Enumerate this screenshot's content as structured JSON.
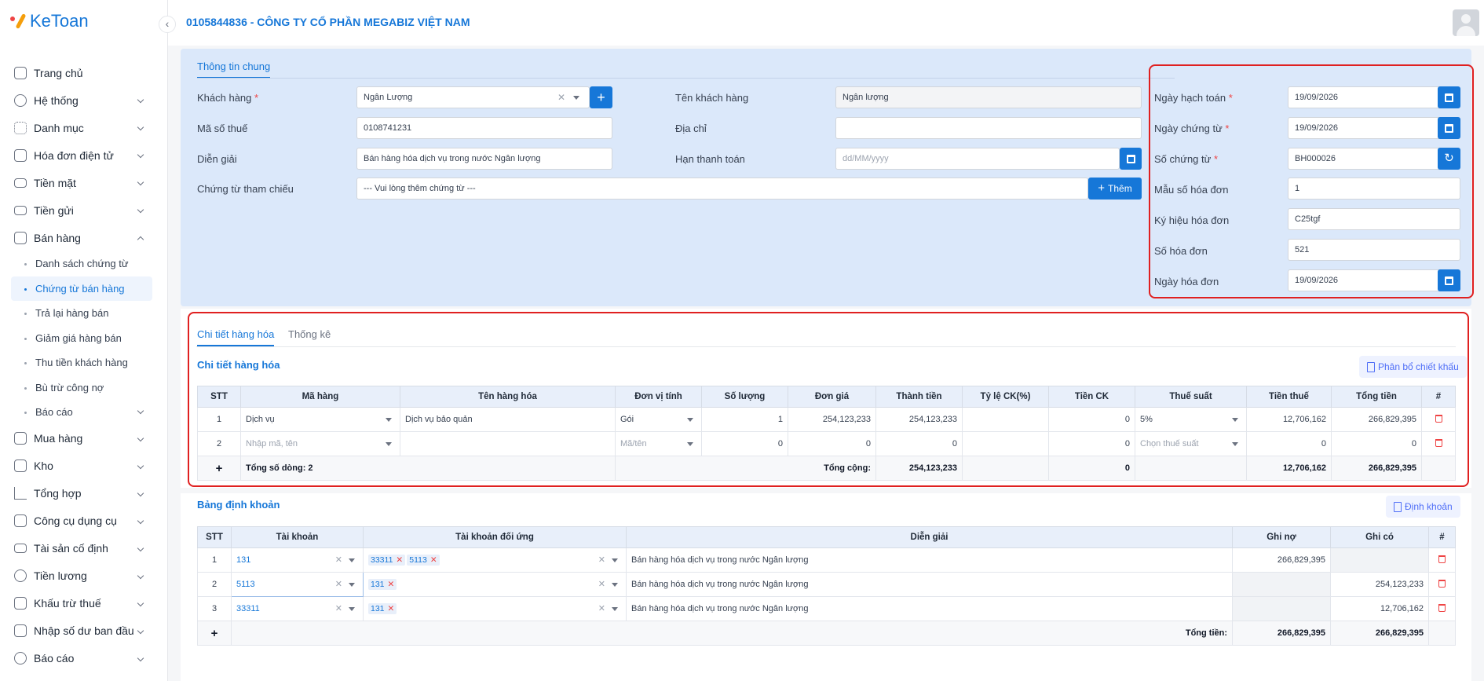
{
  "app": {
    "logo": "KeToan",
    "company": "0105844836 - CÔNG TY CỔ PHẦN MEGABIZ VIỆT NAM"
  },
  "sidebar": {
    "items": [
      {
        "label": "Trang chủ",
        "icon": "home-icon",
        "chev": ""
      },
      {
        "label": "Hệ thống",
        "icon": "gear-icon",
        "chev": "down"
      },
      {
        "label": "Danh mục",
        "icon": "grid-icon",
        "chev": "down"
      },
      {
        "label": "Hóa đơn điện tử",
        "icon": "invoice-icon",
        "chev": "down"
      },
      {
        "label": "Tiền mặt",
        "icon": "cash-icon",
        "chev": "down"
      },
      {
        "label": "Tiền gửi",
        "icon": "card-icon",
        "chev": "down"
      },
      {
        "label": "Bán hàng",
        "icon": "cart-icon",
        "chev": "up"
      }
    ],
    "sub": [
      "Danh sách chứng từ",
      "Chứng từ bán hàng",
      "Trả lại hàng bán",
      "Giảm giá hàng bán",
      "Thu tiền khách hàng",
      "Bù trừ công nợ",
      "Báo cáo"
    ],
    "items2": [
      {
        "label": "Mua hàng",
        "icon": "bag-icon"
      },
      {
        "label": "Kho",
        "icon": "warehouse-icon"
      },
      {
        "label": "Tổng hợp",
        "icon": "chart-icon"
      },
      {
        "label": "Công cụ dụng cụ",
        "icon": "tools-icon"
      },
      {
        "label": "Tài sản cố định",
        "icon": "car-icon"
      },
      {
        "label": "Tiền lương",
        "icon": "dollar-icon"
      },
      {
        "label": "Khấu trừ thuế",
        "icon": "bank-icon"
      },
      {
        "label": "Nhập số dư ban đầu",
        "icon": "edit-icon"
      },
      {
        "label": "Báo cáo",
        "icon": "report-icon"
      }
    ]
  },
  "general": {
    "tab": "Thông tin chung",
    "customer_label": "Khách hàng",
    "customer_value": "Ngân Lượng",
    "tax_label": "Mã số thuế",
    "tax_value": "0108741231",
    "desc_label": "Diễn giải",
    "desc_value": "Bán hàng hóa dịch vụ trong nước Ngân lượng",
    "ref_label": "Chứng từ tham chiếu",
    "ref_placeholder": "--- Vui lòng thêm chứng từ ---",
    "add_label": "Thêm",
    "cname_label": "Tên khách hàng",
    "cname_value": "Ngân lượng",
    "addr_label": "Địa chỉ",
    "addr_value": "",
    "due_label": "Hạn thanh toán",
    "due_placeholder": "dd/MM/yyyy",
    "right": [
      {
        "label": "Ngày hạch toán",
        "req": "*",
        "value": "19/09/2026",
        "btn": "cal"
      },
      {
        "label": "Ngày chứng từ",
        "req": "*",
        "value": "19/09/2026",
        "btn": "cal"
      },
      {
        "label": "Số chứng từ",
        "req": "*",
        "value": "BH000026",
        "btn": "refresh"
      },
      {
        "label": "Mẫu số hóa đơn",
        "req": "",
        "value": "1",
        "btn": ""
      },
      {
        "label": "Ký hiệu hóa đơn",
        "req": "",
        "value": "C25tgf",
        "btn": ""
      },
      {
        "label": "Số hóa đơn",
        "req": "",
        "value": "521",
        "btn": ""
      },
      {
        "label": "Ngày hóa đơn",
        "req": "",
        "value": "19/09/2026",
        "btn": "cal"
      }
    ]
  },
  "detail": {
    "tabs": [
      "Chi tiết hàng hóa",
      "Thống kê"
    ],
    "subtitle": "Chi tiết hàng hóa",
    "alloc_button": "Phân bổ chiết khấu",
    "columns": [
      "STT",
      "Mã hàng",
      "Tên hàng hóa",
      "Đơn vị tính",
      "Số lượng",
      "Đơn giá",
      "Thành tiền",
      "Tỷ lệ CK(%)",
      "Tiền CK",
      "Thuế suất",
      "Tiền thuế",
      "Tổng tiền",
      "#"
    ],
    "rows": [
      {
        "stt": "1",
        "code": "Dịch vụ",
        "name": "Dịch vụ bảo quản",
        "unit": "Gói",
        "qty": "1",
        "price": "254,123,233",
        "amount": "254,123,233",
        "rate": "",
        "disc": "0",
        "vat": "5%",
        "tax": "12,706,162",
        "total": "266,829,395"
      },
      {
        "stt": "2",
        "code": "Nhập mã, tên",
        "name": "",
        "unit": "Mã/tên",
        "qty": "0",
        "price": "0",
        "amount": "0",
        "rate": "",
        "disc": "0",
        "vat": "Chọn thuế suất",
        "tax": "0",
        "total": "0"
      }
    ],
    "footer": {
      "rows": "Tổng số dòng: 2",
      "total_label": "Tổng cộng:",
      "amount": "254,123,233",
      "disc": "0",
      "tax": "12,706,162",
      "total": "266,829,395"
    }
  },
  "posting": {
    "title": "Bảng định khoản",
    "button": "Định khoản",
    "columns": [
      "STT",
      "Tài khoản",
      "Tài khoản đối ứng",
      "Diễn giải",
      "Ghi nợ",
      "Ghi có",
      "#"
    ],
    "rows": [
      {
        "stt": "1",
        "acc": "131",
        "chips": [
          "33311",
          "5113"
        ],
        "desc": "Bán hàng hóa dịch vụ trong nước Ngân lượng",
        "debit": "266,829,395",
        "credit": ""
      },
      {
        "stt": "2",
        "acc": "5113",
        "chips": [
          "131"
        ],
        "desc": "Bán hàng hóa dịch vụ trong nước Ngân lượng",
        "debit": "",
        "credit": "254,123,233"
      },
      {
        "stt": "3",
        "acc": "33311",
        "chips": [
          "131"
        ],
        "desc": "Bán hàng hóa dịch vụ trong nước Ngân lượng",
        "debit": "",
        "credit": "12,706,162"
      }
    ],
    "footer": {
      "label": "Tổng tiền:",
      "debit": "266,829,395",
      "credit": "266,829,395"
    }
  },
  "colors": {
    "accent": "#1677d8",
    "panel": "#dbe8fa",
    "highlight": "#e02020",
    "danger": "#ef4444"
  }
}
